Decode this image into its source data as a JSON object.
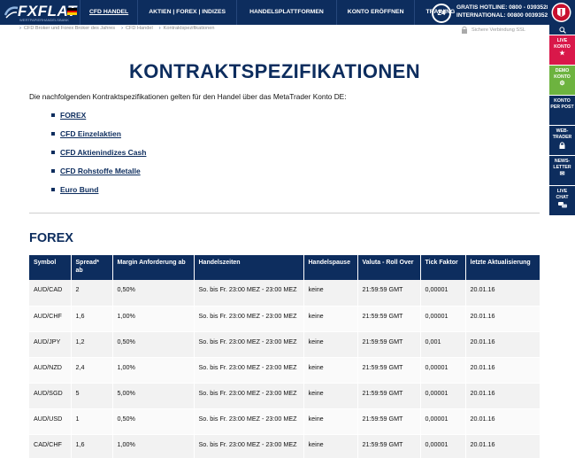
{
  "brand": {
    "logo_text": "FXFLAT",
    "logo_subtitle": "WERTPAPIERHANDELSBANK"
  },
  "nav": {
    "items": [
      {
        "label": "CFD HANDEL",
        "active": true
      },
      {
        "label": "AKTIEN | FOREX | INDIZES",
        "active": false
      },
      {
        "label": "HANDELSPLATTFORMEN",
        "active": false
      },
      {
        "label": "KONTO ERÖFFNEN",
        "active": false
      },
      {
        "label": "TRAINING",
        "active": false
      }
    ]
  },
  "hotline": {
    "badge": "24",
    "line1": "GRATIS HOTLINE: 0800 - 0393528",
    "line2": "INTERNATIONAL: 00800 00393528"
  },
  "breadcrumb": [
    "CFD Broker und Forex Broker des Jahres",
    "CFD Handel",
    "Kontraktspezifikationen"
  ],
  "ssl_label": "Sichere Verbindung SSL",
  "sidebar": [
    {
      "label1": "LIVE",
      "label2": "KONTO",
      "label3": "",
      "icon": "star-icon",
      "glyph": "★",
      "color": "#d9184a"
    },
    {
      "label1": "DEMO",
      "label2": "KONTO",
      "label3": "",
      "icon": "coins-icon",
      "glyph": "⚙",
      "color": "#6db33f"
    },
    {
      "label1": "KONTO",
      "label2": "PER POST",
      "label3": "",
      "icon": "",
      "glyph": "",
      "color": "#0d2d5e"
    },
    {
      "label1": "WEB-",
      "label2": "TRADER",
      "label3": "",
      "icon": "lock-icon",
      "glyph": "🔒",
      "color": "#0d2d5e"
    },
    {
      "label1": "NEWS-",
      "label2": "LETTER",
      "label3": "",
      "icon": "mail-icon",
      "glyph": "✉",
      "color": "#0d2d5e"
    },
    {
      "label1": "LIVE",
      "label2": "CHAT",
      "label3": "",
      "icon": "chat-icon",
      "glyph": "💬",
      "color": "#0d2d5e"
    }
  ],
  "page": {
    "title": "KONTRAKTSPEZIFIKATIONEN",
    "intro": "Die nachfolgenden Kontraktspezifikationen gelten für den Handel über das MetaTrader Konto DE:",
    "links": [
      "FOREX",
      "CFD Einzelaktien",
      "CFD Aktienindizes Cash",
      "CFD Rohstoffe Metalle",
      "Euro Bund"
    ],
    "section_title": "FOREX"
  },
  "table": {
    "headers": [
      "Symbol",
      "Spread* ab",
      "Margin Anforderung ab",
      "Handelszeiten",
      "Handelspause",
      "Valuta - Roll Over",
      "Tick Faktor",
      "letzte Aktualisierung"
    ],
    "rows": [
      [
        "AUD/CAD",
        "2",
        "0,50%",
        "So. bis Fr. 23:00 MEZ - 23:00 MEZ",
        "keine",
        "21:59:59 GMT",
        "0,00001",
        "20.01.16"
      ],
      [
        "AUD/CHF",
        "1,6",
        "1,00%",
        "So. bis Fr. 23:00 MEZ - 23:00 MEZ",
        "keine",
        "21:59:59 GMT",
        "0,00001",
        "20.01.16"
      ],
      [
        "AUD/JPY",
        "1,2",
        "0,50%",
        "So. bis Fr. 23:00 MEZ - 23:00 MEZ",
        "keine",
        "21:59:59 GMT",
        "0,001",
        "20.01.16"
      ],
      [
        "AUD/NZD",
        "2,4",
        "1,00%",
        "So. bis Fr. 23:00 MEZ - 23:00 MEZ",
        "keine",
        "21:59:59 GMT",
        "0,00001",
        "20.01.16"
      ],
      [
        "AUD/SGD",
        "5",
        "5,00%",
        "So. bis Fr. 23:00 MEZ - 23:00 MEZ",
        "keine",
        "21:59:59 GMT",
        "0,00001",
        "20.01.16"
      ],
      [
        "AUD/USD",
        "1",
        "0,50%",
        "So. bis Fr. 23:00 MEZ - 23:00 MEZ",
        "keine",
        "21:59:59 GMT",
        "0,00001",
        "20.01.16"
      ],
      [
        "CAD/CHF",
        "1,6",
        "1,00%",
        "So. bis Fr. 23:00 MEZ - 23:00 MEZ",
        "keine",
        "21:59:59 GMT",
        "0,00001",
        "20.01.16"
      ]
    ]
  },
  "colors": {
    "brand_navy": "#0d2d5e",
    "live_red": "#d9184a",
    "demo_green": "#6db33f"
  }
}
